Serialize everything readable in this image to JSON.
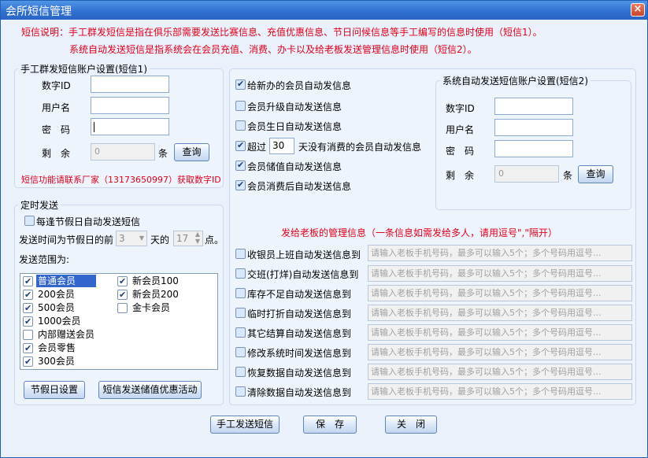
{
  "window": {
    "title": "会所短信管理",
    "close_glyph": "×"
  },
  "notes": {
    "line1": "短信说明：手工群发短信是指在俱乐部需要发送比赛信息、充值优惠信息、节日问候信息等手工编写的信息时使用（短信1）。",
    "line2": "系统自动发送短信是指系统会在会员充值、消费、办卡以及给老板发送管理信息时使用（短信2）。"
  },
  "manual_account": {
    "legend": "手工群发短信账户设置(短信1)",
    "id_label": "数字ID",
    "user_label": "用户名",
    "pwd_label": "密　码",
    "remain_label": "剩　余",
    "remain_value": "0",
    "unit": "条",
    "query_button": "查询",
    "contact_note": "短信功能请联系厂家（13173650997）获取数字ID"
  },
  "auto_options": [
    {
      "label": "给新办的会员自动发信息",
      "checked": true
    },
    {
      "label": "会员升级自动发送信息",
      "checked": false
    },
    {
      "label": "会员生日自动发送信息",
      "checked": false
    },
    {
      "label_before": "超过",
      "days": "30",
      "label_after": "天没有消费的会员自动发信息",
      "checked": true
    },
    {
      "label": "会员储值自动发送信息",
      "checked": true
    },
    {
      "label": "会员消费后自动发送信息",
      "checked": true
    }
  ],
  "auto_account": {
    "legend": "系统自动发送短信账户设置(短信2)",
    "id_label": "数字ID",
    "user_label": "用户名",
    "pwd_label": "密　码",
    "remain_label": "剩　余",
    "remain_value": "0",
    "unit": "条",
    "query_button": "查询"
  },
  "schedule": {
    "legend": "定时发送",
    "holiday_auto": "每逢节假日自动发送短信",
    "holiday_auto_checked": false,
    "time_prefix": "发送时间为节假日的前",
    "days_value": "3",
    "days_unit": "天的",
    "hour_value": "17",
    "hour_unit": "点。",
    "range_label": "发送范围为:",
    "members": [
      {
        "label": "普通会员",
        "checked": true,
        "selected": true
      },
      {
        "label": "200会员",
        "checked": true
      },
      {
        "label": "500会员",
        "checked": true
      },
      {
        "label": "1000会员",
        "checked": true
      },
      {
        "label": "内部赠送会员",
        "checked": false
      },
      {
        "label": "会员零售",
        "checked": true
      },
      {
        "label": "300会员",
        "checked": true
      },
      {
        "label": "新会员100",
        "checked": true
      },
      {
        "label": "新会员200",
        "checked": true
      },
      {
        "label": "金卡会员",
        "checked": false
      }
    ],
    "holiday_button": "节假日设置",
    "promo_button": "短信发送储值优惠活动"
  },
  "boss": {
    "title": "发给老板的管理信息（一条信息如需发给多人，请用逗号\",\"隔开）",
    "placeholder": "请输入老板手机号码，最多可以输入5个；多个号码用逗号...",
    "items": [
      {
        "label": "收银员上班自动发送信息到",
        "checked": false
      },
      {
        "label": "交班(打烊)自动发送信息到",
        "checked": false
      },
      {
        "label": "库存不足自动发送信息到",
        "checked": false
      },
      {
        "label": "临时打折自动发送信息到",
        "checked": false
      },
      {
        "label": "其它结算自动发送信息到",
        "checked": false
      },
      {
        "label": "修改系统时间发送信息到",
        "checked": false
      },
      {
        "label": "恢复数据自动发送信息到",
        "checked": false
      },
      {
        "label": "清除数据自动发送信息到",
        "checked": false
      }
    ]
  },
  "footer": {
    "manual_send": "手工发送短信",
    "save": "保　存",
    "close": "关　闭"
  },
  "colors": {
    "title_bar": "#2f6fd0",
    "note_text": "#e0001b",
    "window_bg": "#eaf1fb"
  }
}
